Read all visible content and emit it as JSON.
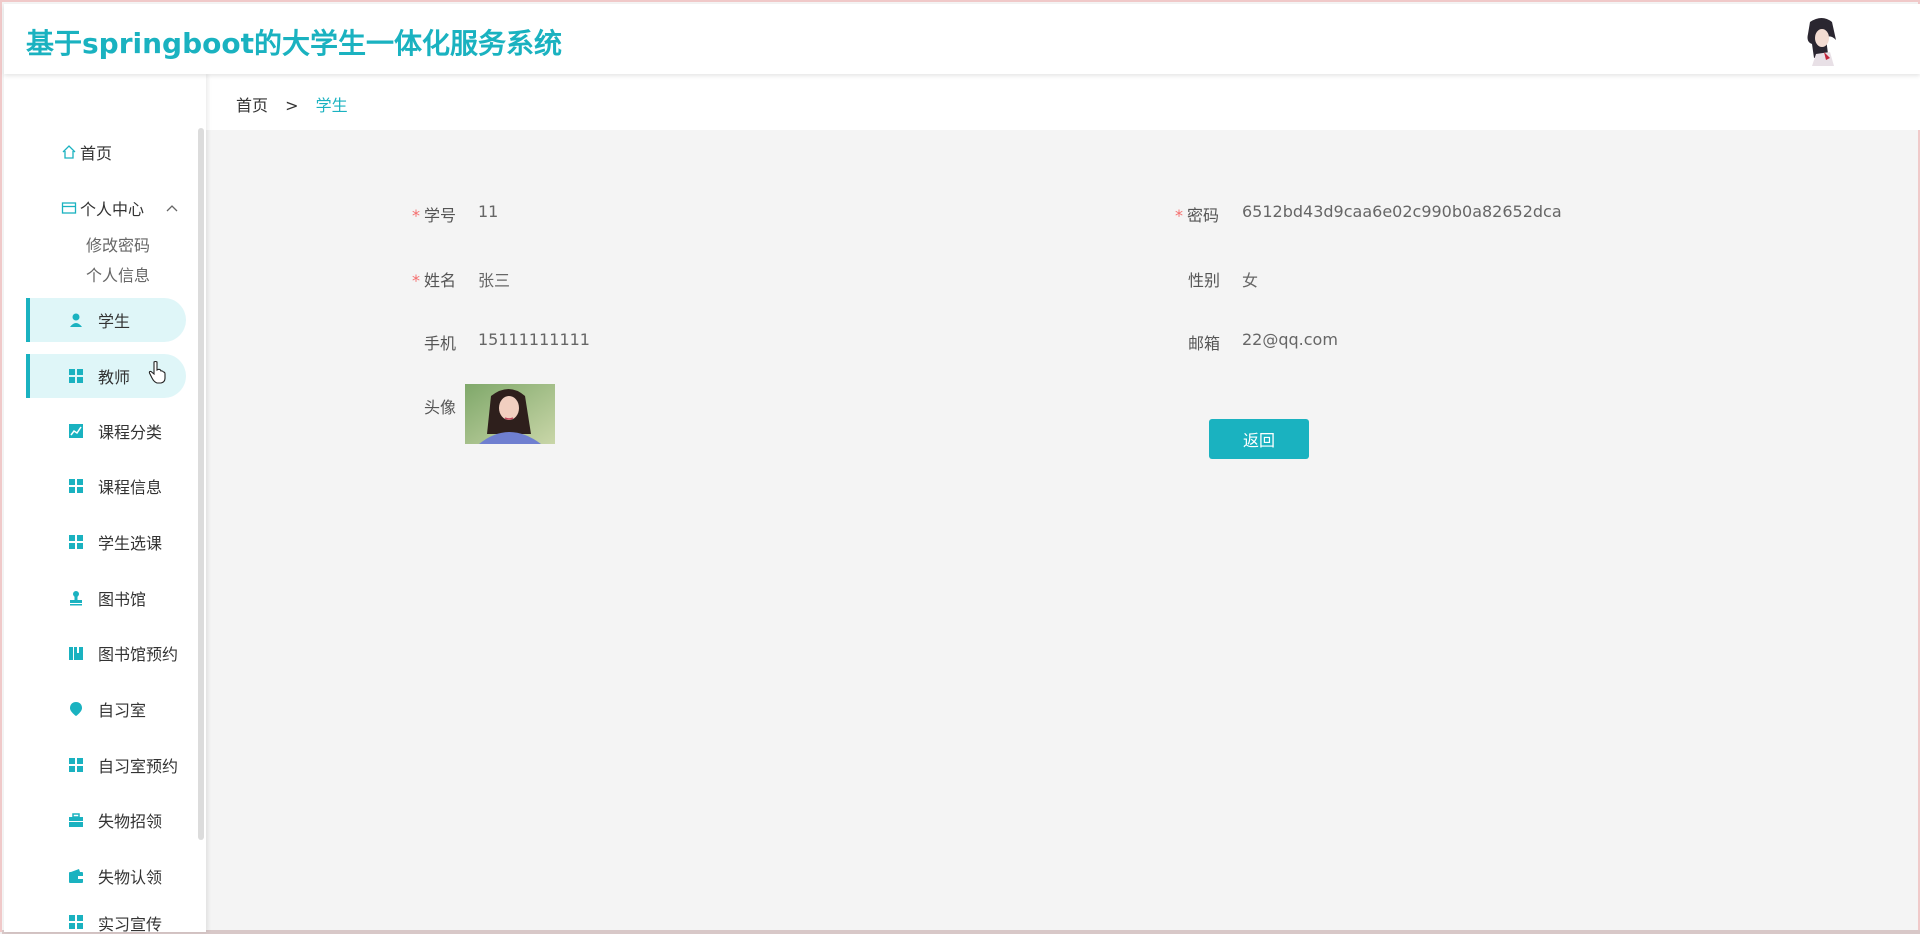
{
  "header": {
    "title": "基于springboot的大学生一体化服务系统",
    "avatar_icon": "user-avatar-icon"
  },
  "sidebar": {
    "home": {
      "label": "首页",
      "icon": "home-icon"
    },
    "personal_center": {
      "label": "个人中心",
      "icon": "card-icon",
      "expanded": true,
      "children": [
        "修改密码",
        "个人信息"
      ]
    },
    "items": [
      {
        "label": "学生",
        "icon": "user-icon",
        "active": true
      },
      {
        "label": "教师",
        "icon": "grid-icon",
        "active": true
      },
      {
        "label": "课程分类",
        "icon": "chart-icon"
      },
      {
        "label": "课程信息",
        "icon": "grid-icon"
      },
      {
        "label": "学生选课",
        "icon": "grid-icon"
      },
      {
        "label": "图书馆",
        "icon": "stamp-icon"
      },
      {
        "label": "图书馆预约",
        "icon": "book-icon"
      },
      {
        "label": "自习室",
        "icon": "location-icon"
      },
      {
        "label": "自习室预约",
        "icon": "grid-icon"
      },
      {
        "label": "失物招领",
        "icon": "briefcase-icon"
      },
      {
        "label": "失物认领",
        "icon": "wallet-icon"
      },
      {
        "label": "实习宣传",
        "icon": "grid-icon"
      }
    ]
  },
  "breadcrumb": {
    "home": "首页",
    "separator": ">",
    "current": "学生"
  },
  "form": {
    "student_id": {
      "label": "学号",
      "value": "11",
      "required": true
    },
    "password": {
      "label": "密码",
      "value": "6512bd43d9caa6e02c990b0a82652dca",
      "required": true
    },
    "name": {
      "label": "姓名",
      "value": "张三",
      "required": true
    },
    "gender": {
      "label": "性别",
      "value": "女",
      "required": false
    },
    "phone": {
      "label": "手机",
      "value": "15111111111",
      "required": false
    },
    "email": {
      "label": "邮箱",
      "value": "22@qq.com",
      "required": false
    },
    "avatar": {
      "label": "头像"
    },
    "back_button": "返回"
  },
  "colors": {
    "accent": "#1ab2c0",
    "required": "#f56c6c",
    "active_bg": "#dff6f8"
  }
}
